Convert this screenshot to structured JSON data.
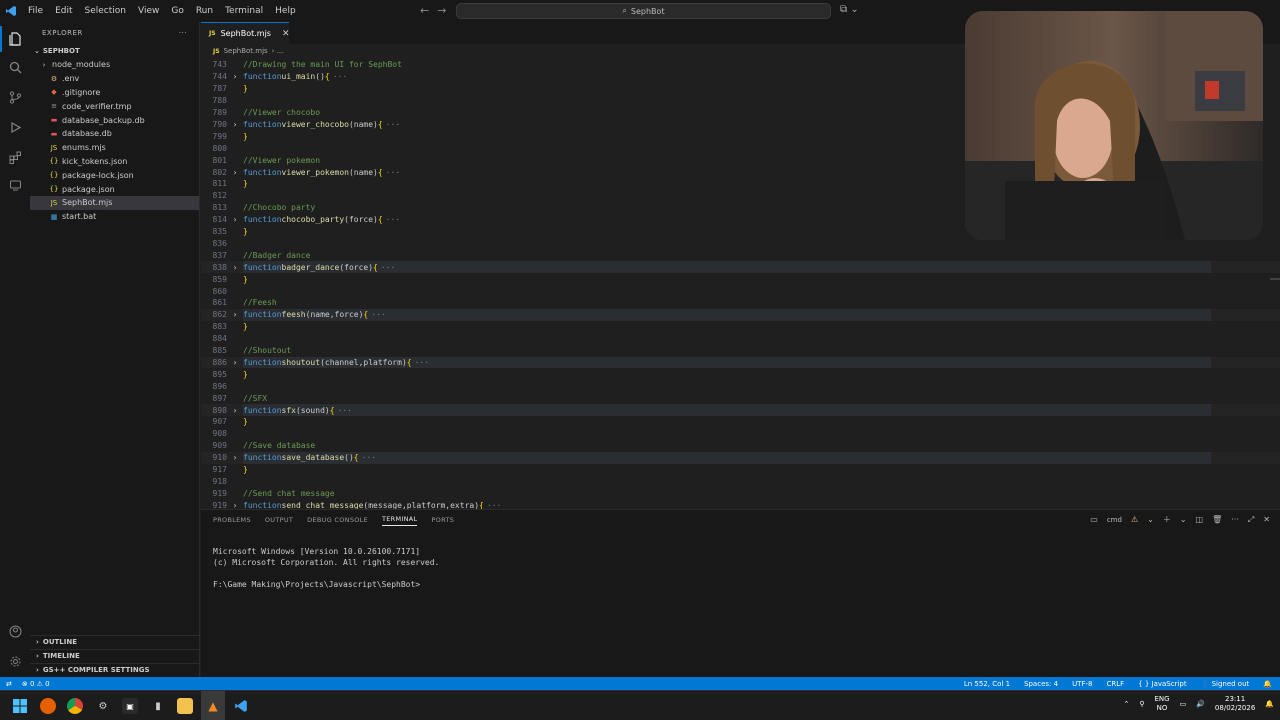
{
  "window": {
    "search_text": "SephBot",
    "menu": [
      "File",
      "Edit",
      "Selection",
      "View",
      "Go",
      "Run",
      "Terminal",
      "Help"
    ]
  },
  "sidebar": {
    "title": "EXPLORER",
    "root_folder": "SEPHBOT",
    "items": [
      {
        "label": "node_modules",
        "icon": "folder-icon",
        "color": "#cccccc",
        "icon_color": "#cccccc",
        "icon_text": "›"
      },
      {
        "label": ".env",
        "icon": "gear-icon",
        "color": "#cccccc",
        "icon_color": "#e5c07b",
        "icon_text": "⚙"
      },
      {
        "label": ".gitignore",
        "icon": "git-icon",
        "color": "#cccccc",
        "icon_color": "#e06c3c",
        "icon_text": "◆"
      },
      {
        "label": "code_verifier.tmp",
        "icon": "file-icon",
        "color": "#cccccc",
        "icon_color": "#9d9d9d",
        "icon_text": "≡"
      },
      {
        "label": "database_backup.db",
        "icon": "database-icon",
        "color": "#cccccc",
        "icon_color": "#e05561",
        "icon_text": "▬"
      },
      {
        "label": "database.db",
        "icon": "database-icon",
        "color": "#cccccc",
        "icon_color": "#e05561",
        "icon_text": "▬"
      },
      {
        "label": "enums.mjs",
        "icon": "js-icon",
        "color": "#cccccc",
        "icon_color": "#e8d44d",
        "icon_text": "JS"
      },
      {
        "label": "kick_tokens.json",
        "icon": "json-icon",
        "color": "#cccccc",
        "icon_color": "#e8d44d",
        "icon_text": "{}"
      },
      {
        "label": "package-lock.json",
        "icon": "json-icon",
        "color": "#cccccc",
        "icon_color": "#e8d44d",
        "icon_text": "{}"
      },
      {
        "label": "package.json",
        "icon": "json-icon",
        "color": "#cccccc",
        "icon_color": "#e8d44d",
        "icon_text": "{}"
      },
      {
        "label": "SephBot.mjs",
        "icon": "js-icon",
        "color": "#cccccc",
        "icon_color": "#e8d44d",
        "icon_text": "JS"
      },
      {
        "label": "start.bat",
        "icon": "windows-icon",
        "color": "#cccccc",
        "icon_color": "#4aa8e8",
        "icon_text": "▦"
      }
    ],
    "bottom_sections": [
      "OUTLINE",
      "TIMELINE",
      "GS++ COMPILER SETTINGS"
    ]
  },
  "editor": {
    "tab_label": "SephBot.mjs",
    "tab_badge": "JS",
    "breadcrumb": "SephBot.mjs",
    "breadcrumb_sep": "› ...",
    "lines": [
      {
        "n": "743",
        "type": "comment",
        "text": "//Drawing the main UI for SephBot"
      },
      {
        "n": "744",
        "type": "func",
        "name": "ui_main",
        "params": "()",
        "hl": false
      },
      {
        "n": "787",
        "type": "close"
      },
      {
        "n": "788",
        "type": "blank"
      },
      {
        "n": "789",
        "type": "comment",
        "text": "//Viewer chocobo"
      },
      {
        "n": "790",
        "type": "func",
        "name": "viewer_chocobo",
        "params": "(name)",
        "hl": false
      },
      {
        "n": "799",
        "type": "close"
      },
      {
        "n": "800",
        "type": "blank"
      },
      {
        "n": "801",
        "type": "comment",
        "text": "//Viewer pokemon"
      },
      {
        "n": "802",
        "type": "func",
        "name": "viewer_pokemon",
        "params": "(name)",
        "hl": false
      },
      {
        "n": "811",
        "type": "close"
      },
      {
        "n": "812",
        "type": "blank"
      },
      {
        "n": "813",
        "type": "comment",
        "text": "//Chocobo party"
      },
      {
        "n": "814",
        "type": "func",
        "name": "chocobo_party",
        "params": "(force)",
        "hl": false
      },
      {
        "n": "835",
        "type": "close"
      },
      {
        "n": "836",
        "type": "blank"
      },
      {
        "n": "837",
        "type": "comment",
        "text": "//Badger dance"
      },
      {
        "n": "838",
        "type": "func",
        "name": "badger_dance",
        "params": "(force)",
        "hl": true
      },
      {
        "n": "859",
        "type": "close"
      },
      {
        "n": "860",
        "type": "blank"
      },
      {
        "n": "861",
        "type": "comment",
        "text": "//Feesh"
      },
      {
        "n": "862",
        "type": "func",
        "name": "feesh",
        "params": "(name,force)",
        "hl": true
      },
      {
        "n": "883",
        "type": "close"
      },
      {
        "n": "884",
        "type": "blank"
      },
      {
        "n": "885",
        "type": "comment",
        "text": "//Shoutout"
      },
      {
        "n": "886",
        "type": "func",
        "name": "shoutout",
        "params": "(channel,platform)",
        "hl": true
      },
      {
        "n": "895",
        "type": "close"
      },
      {
        "n": "896",
        "type": "blank"
      },
      {
        "n": "897",
        "type": "comment",
        "text": "//SFX"
      },
      {
        "n": "898",
        "type": "func",
        "name": "sfx",
        "params": "(sound)",
        "hl": true
      },
      {
        "n": "907",
        "type": "close"
      },
      {
        "n": "908",
        "type": "blank"
      },
      {
        "n": "909",
        "type": "comment",
        "text": "//Save database"
      },
      {
        "n": "910",
        "type": "func",
        "name": "save_database",
        "params": "()",
        "hl": true
      },
      {
        "n": "917",
        "type": "close"
      },
      {
        "n": "918",
        "type": "blank"
      },
      {
        "n": "919",
        "type": "comment",
        "text": "//Send chat message"
      },
      {
        "n": "919",
        "type": "func",
        "name": "send_chat_message",
        "params": "(message,platform,extra)",
        "hl": false
      }
    ]
  },
  "panel": {
    "tabs": [
      "PROBLEMS",
      "OUTPUT",
      "DEBUG CONSOLE",
      "TERMINAL",
      "PORTS"
    ],
    "active_tab": "TERMINAL",
    "shell_label": "cmd",
    "terminal_lines": [
      "Microsoft Windows [Version 10.0.26100.7171]",
      "(c) Microsoft Corporation. All rights reserved.",
      "",
      "F:\\Game Making\\Projects\\Javascript\\SephBot>"
    ]
  },
  "statusbar": {
    "errors": "0",
    "warnings": "0",
    "cursor": "Ln 552, Col 1",
    "spaces": "Spaces: 4",
    "encoding": "UTF-8",
    "eol": "CRLF",
    "language": "JavaScript",
    "account": "Signed out"
  },
  "taskbar": {
    "lang_top": "ENG",
    "lang_bottom": "NO",
    "time": "23:11",
    "date": "08/02/2026"
  },
  "colors": {
    "accent": "#0078d4",
    "keyword": "#569cd6",
    "function": "#dcdcaa",
    "comment": "#6a9955",
    "bracket": "#ffd700"
  }
}
